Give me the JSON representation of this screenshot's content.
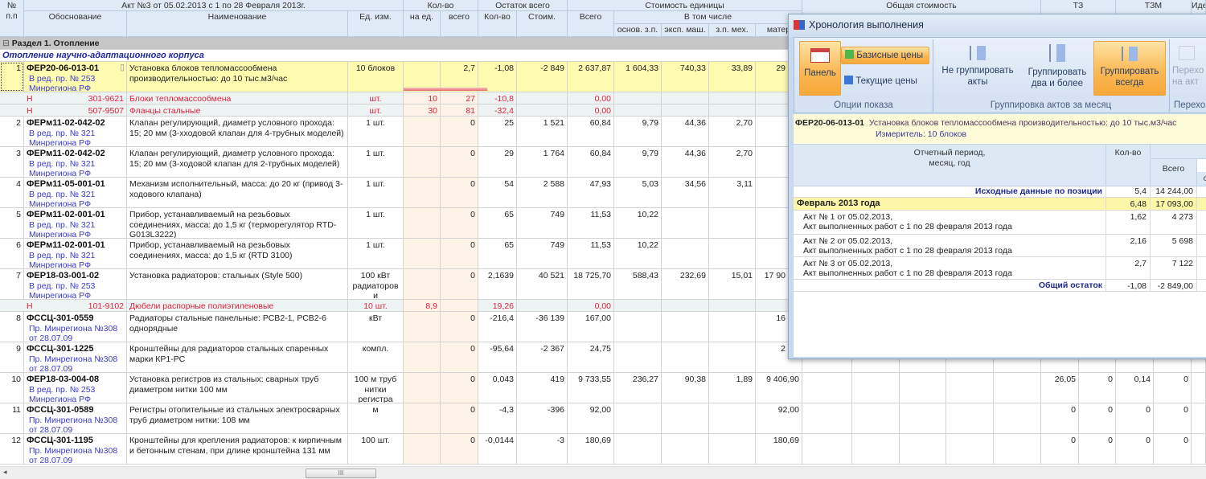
{
  "header": {
    "num": "№\nп.п",
    "act": "Акт №3 от 05.02.2013 с 1 по 28 Февраля 2013г.",
    "basis": "Обоснование",
    "name": "Наименование",
    "unit": "Ед. изм.",
    "qty": "Кол-во",
    "qty_per": "на ед.",
    "qty_total": "всего",
    "rest": "Остаток всего",
    "rest_qty": "Кол-во",
    "rest_cost": "Стоим.",
    "unit_cost": "Стоимость единицы",
    "uc_total": "Всего",
    "incl": "В том числе",
    "zp": "основ. з.п.",
    "mash": "эксп. маш.",
    "zpm": "з.п. мех.",
    "mat": "матер",
    "total_cost": "Общая стоимость",
    "tz": "ТЗ",
    "tzm": "ТЗМ",
    "ide": "Иде"
  },
  "section": {
    "label": "Раздел 1. Отопление",
    "subtitle": "Отопление научно-адаптационного корпуса"
  },
  "rows": [
    {
      "type": "item",
      "n": "1",
      "code": "ФЕР20-06-013-01",
      "sub": "В ред. пр. № 253\nМинрегиона РФ",
      "name": "Установка блоков тепломассообмена производительностью: до 10 тыс.м3/час",
      "unit": "10 блоков",
      "per": "",
      "tot": "2,7",
      "rq": "-1,08",
      "rc": "-2 849",
      "uc": "2 637,87",
      "zp": "1 604,33",
      "mash": "740,33",
      "zpm": "33,89",
      "mat": "29",
      "tz": [
        "",
        "",
        "",
        ""
      ],
      "selected": true,
      "exp": "⊞⊞"
    },
    {
      "type": "res",
      "code": "Н",
      "num": "301-9621",
      "name": "Блоки тепломассообмена",
      "unit": "шт.",
      "per": "10",
      "tot": "27",
      "rq": "-10,8",
      "uc": "0,00"
    },
    {
      "type": "res",
      "code": "Н",
      "num": "507-9507",
      "name": "Фланцы стальные",
      "unit": "шт.",
      "per": "30",
      "tot": "81",
      "rq": "-32,4",
      "uc": "0,00"
    },
    {
      "type": "item",
      "n": "2",
      "code": "ФЕРм11-02-042-02",
      "sub": "В ред. пр. № 321\nМинрегиона РФ",
      "name": "Клапан регулирующий, диаметр условного прохода: 15; 20 мм (3-хходовой клапан для 4-трубных моделей)",
      "unit": "1 шт.",
      "per": "",
      "tot": "0",
      "rq": "25",
      "rc": "1 521",
      "uc": "60,84",
      "zp": "9,79",
      "mash": "44,36",
      "zpm": "2,70",
      "mat": "",
      "tz": [
        "",
        "",
        "",
        ""
      ],
      "exp": "⊞⊞"
    },
    {
      "type": "item",
      "n": "3",
      "code": "ФЕРм11-02-042-02",
      "sub": "В ред. пр. № 321\nМинрегиона РФ",
      "name": "Клапан регулирующий, диаметр условного прохода: 15; 20 мм (3-ходовой клапан для 2-трубных моделей)",
      "unit": "1 шт.",
      "per": "",
      "tot": "0",
      "rq": "29",
      "rc": "1 764",
      "uc": "60,84",
      "zp": "9,79",
      "mash": "44,36",
      "zpm": "2,70",
      "mat": "",
      "tz": [
        "",
        "",
        "",
        ""
      ],
      "exp": "⊞⊞"
    },
    {
      "type": "item",
      "n": "4",
      "code": "ФЕРм11-05-001-01",
      "sub": "В ред. пр. № 321\nМинрегиона РФ",
      "name": "Механизм исполнительный, масса: до 20 кг (привод 3-ходового клапана)",
      "unit": "1 шт.",
      "per": "",
      "tot": "0",
      "rq": "54",
      "rc": "2 588",
      "uc": "47,93",
      "zp": "5,03",
      "mash": "34,56",
      "zpm": "3,11",
      "mat": "",
      "tz": [
        "",
        "",
        "",
        ""
      ],
      "exp": "⊞⊞"
    },
    {
      "type": "item",
      "n": "5",
      "code": "ФЕРм11-02-001-01",
      "sub": "В ред. пр. № 321\nМинрегиона РФ",
      "name": "Прибор, устанавливаемый на резьбовых соединениях, масса: до 1,5 кг (терморегулятор RTD-G013L3222)",
      "unit": "1 шт.",
      "per": "",
      "tot": "0",
      "rq": "65",
      "rc": "749",
      "uc": "11,53",
      "zp": "10,22",
      "mash": "",
      "zpm": "",
      "mat": "",
      "tz": [
        "",
        "",
        "",
        ""
      ],
      "exp": "⊞⊞"
    },
    {
      "type": "item",
      "n": "6",
      "code": "ФЕРм11-02-001-01",
      "sub": "В ред. пр. № 321\nМинрегиона РФ",
      "name": "Прибор, устанавливаемый на резьбовых соединениях, масса: до 1,5 кг (RTD 3100)",
      "unit": "1 шт.",
      "per": "",
      "tot": "0",
      "rq": "65",
      "rc": "749",
      "uc": "11,53",
      "zp": "10,22",
      "mash": "",
      "zpm": "",
      "mat": "",
      "tz": [
        "",
        "",
        "",
        ""
      ],
      "exp": "⊞⊞"
    },
    {
      "type": "item",
      "n": "7",
      "code": "ФЕР18-03-001-02",
      "sub": "В ред. пр. № 253\nМинрегиона РФ",
      "name": "Установка радиаторов: стальных (Style 500)",
      "unit": "100 кВт радиаторов и конвекторов",
      "per": "",
      "tot": "0",
      "rq": "2,1639",
      "rc": "40 521",
      "uc": "18 725,70",
      "zp": "588,43",
      "mash": "232,69",
      "zpm": "15,01",
      "mat": "17 90",
      "tz": [
        "",
        "",
        "",
        ""
      ],
      "exp": "⊞⊞"
    },
    {
      "type": "res",
      "code": "Н",
      "num": "101-9102",
      "name": "Дюбели распорные полиэтиленовые",
      "unit": "10 шт.",
      "per": "8,9",
      "tot": "",
      "rq": "19,26",
      "uc": "0,00"
    },
    {
      "type": "item",
      "n": "8",
      "code": "ФССЦ-301-0559",
      "sub": "Пр. Минрегиона №308 от 28.07.09",
      "name": "Радиаторы стальные панельные: РСВ2-1, РСВ2-6 однорядные",
      "unit": "кВт",
      "per": "",
      "tot": "0",
      "rq": "-216,4",
      "rc": "-36 139",
      "uc": "167,00",
      "zp": "",
      "mash": "",
      "zpm": "",
      "mat": "16",
      "tz": [
        "",
        "",
        "",
        ""
      ],
      "exp": "⊞"
    },
    {
      "type": "item",
      "n": "9",
      "code": "ФССЦ-301-1225",
      "sub": "Пр. Минрегиона №308 от 28.07.09",
      "name": "Кронштейны для радиаторов стальных спаренных марки КР1-РС",
      "unit": "компл.",
      "per": "",
      "tot": "0",
      "rq": "-95,64",
      "rc": "-2 367",
      "uc": "24,75",
      "zp": "",
      "mash": "",
      "zpm": "",
      "mat": "2",
      "tz": [
        "",
        "",
        "",
        ""
      ],
      "exp": "⊞"
    },
    {
      "type": "item",
      "n": "10",
      "code": "ФЕР18-03-004-08",
      "sub": "В ред. пр. № 253\nМинрегиона РФ",
      "name": "Установка регистров из стальных: сварных труб диаметром нитки 100 мм",
      "unit": "100 м труб нитки регистра",
      "per": "",
      "tot": "0",
      "rq": "0,043",
      "rc": "419",
      "uc": "9 733,55",
      "zp": "236,27",
      "mash": "90,38",
      "zpm": "1,89",
      "mat": "9 406,90",
      "tz": [
        "26,05",
        "0",
        "0,14",
        "0"
      ],
      "exp": "⊞⊞"
    },
    {
      "type": "item",
      "n": "11",
      "code": "ФССЦ-301-0589",
      "sub": "Пр. Минрегиона №308 от 28.07.09",
      "name": "Регистры отопительные из стальных электросварных труб диаметром нитки: 108 мм",
      "unit": "м",
      "per": "",
      "tot": "0",
      "rq": "-4,3",
      "rc": "-396",
      "uc": "92,00",
      "zp": "",
      "mash": "",
      "zpm": "",
      "mat": "92,00",
      "tz": [
        "0",
        "0",
        "0",
        "0"
      ],
      "exp": "⊞"
    },
    {
      "type": "item",
      "n": "12",
      "code": "ФССЦ-301-1195",
      "sub": "Пр. Минрегиона №308 от 28.07.09",
      "name": "Кронштейны для крепления радиаторов: к кирпичным и бетонным стенам, при длине кронштейна 131 мм",
      "unit": "100 шт.",
      "per": "",
      "tot": "0",
      "rq": "-0,0144",
      "rc": "-3",
      "uc": "180,69",
      "zp": "",
      "mash": "",
      "zpm": "",
      "mat": "180,69",
      "tz": [
        "0",
        "0",
        "0",
        "0"
      ],
      "exp": "⊞"
    }
  ],
  "dialog": {
    "title": "Хронология выполнения",
    "ribbon": {
      "panel": "Панель",
      "base": "Базисные цены",
      "current": "Текущие цены",
      "group1": "Опции показа",
      "nogroup": "Не группировать\nакты",
      "group2": "Группировать\nдва и более",
      "groupall": "Группировать\nвсегда",
      "group2label": "Группировка актов за месяц",
      "goto": "Перехо\nна акт",
      "group3": "Перехо"
    },
    "info": {
      "code": "ФЕР20-06-013-01",
      "name": "Установка блоков тепломассообмена производительностью: до 10 тыс.м3/час",
      "meter": "Измеритель: 10 блоков"
    },
    "cols": {
      "period": "Отчетный период,\nмесяц, год",
      "qty": "Кол-во",
      "total": "Всего",
      "o": "о"
    },
    "initial": {
      "label": "Исходные данные по позиции",
      "qty": "5,4",
      "total": "14 244,00"
    },
    "month": {
      "label": "Февраль 2013 года",
      "qty": "6,48",
      "total": "17 093,00"
    },
    "acts": [
      {
        "line1": "Акт № 1 от 05.02.2013,",
        "line2": "Акт выполненных работ с 1 по 28 февраля 2013 года",
        "qty": "1,62",
        "total": "4 273"
      },
      {
        "line1": "Акт № 2 от 05.02.2013,",
        "line2": "Акт выполненных работ с 1 по 28 февраля 2013 года",
        "qty": "2,16",
        "total": "5 698"
      },
      {
        "line1": "Акт № 3 от 05.02.2013,",
        "line2": "Акт выполненных работ с 1 по 28 февраля 2013 года",
        "qty": "2,7",
        "total": "7 122"
      }
    ],
    "rest": {
      "label": "Общий остаток",
      "qty": "-1,08",
      "total": "-2 849,00"
    }
  },
  "scrollbar": {
    "thumb": "III"
  },
  "colors": {
    "selected_row": "#fdfbb0",
    "resource_row": "#eef4f4",
    "resource_text": "#e0203a",
    "link": "#3a3ad0",
    "accent_orange": "#fbb955",
    "header_bg": "#dfeaf6"
  }
}
